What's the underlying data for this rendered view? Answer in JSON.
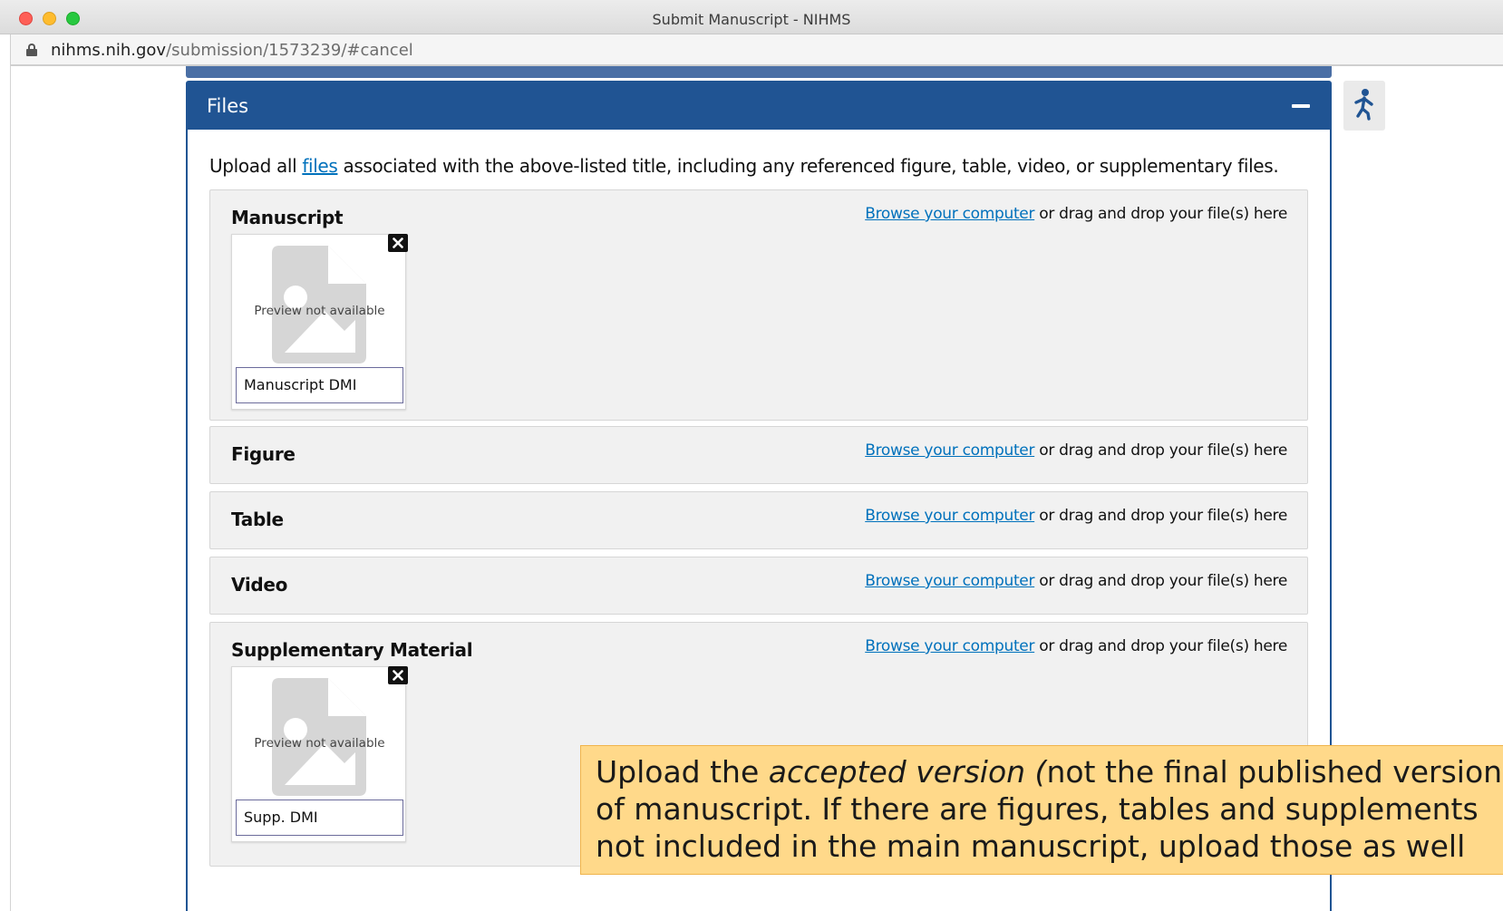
{
  "window": {
    "title": "Submit Manuscript - NIHMS"
  },
  "address_bar": {
    "host": "nihms.nih.gov",
    "path": "/submission/1573239/#cancel"
  },
  "files_panel": {
    "title": "Files",
    "intro_prefix": "Upload all ",
    "intro_link": "files",
    "intro_suffix": " associated with the above-listed title, including any referenced figure, table, video, or supplementary files.",
    "browse_link": "Browse your computer",
    "browse_suffix": " or drag and drop your file(s) here",
    "preview_text": "Preview not available",
    "sections": [
      {
        "title": "Manuscript",
        "file_name": "Manuscript DMI"
      },
      {
        "title": "Figure"
      },
      {
        "title": "Table"
      },
      {
        "title": "Video"
      },
      {
        "title": "Supplementary Material",
        "file_name": "Supp. DMI"
      }
    ]
  },
  "callout": {
    "part1": "Upload the ",
    "italic": "accepted version (",
    "part2": "not the final published version) of manuscript. If there are figures, tables and supplements not included in the main manuscript, upload those as well"
  },
  "colors": {
    "panel_header": "#205493",
    "link": "#0071bc",
    "section_bg": "#f1f1f1",
    "callout_bg": "#ffd98a"
  },
  "icons": [
    "lock-icon",
    "minus-icon",
    "close-icon",
    "image-placeholder-icon",
    "accessibility-icon"
  ]
}
